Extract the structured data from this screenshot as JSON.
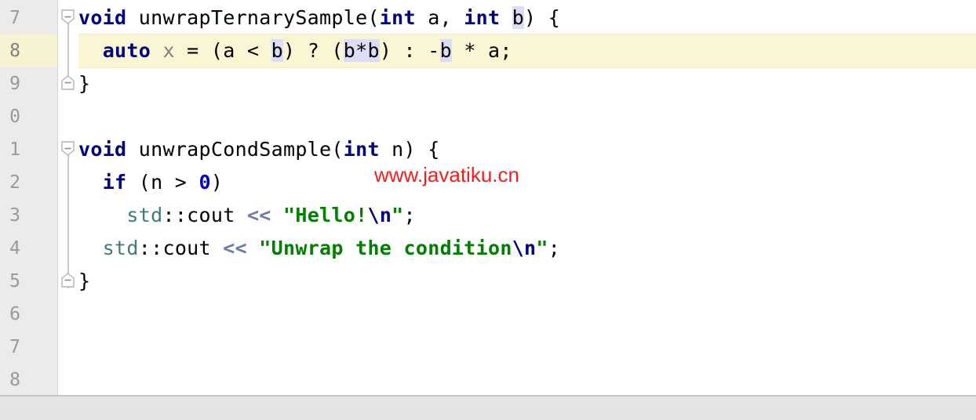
{
  "editor": {
    "language": "cpp",
    "line_height_px": 42,
    "first_visible_line": 7,
    "caret_line": 8,
    "colors": {
      "gutter_background": "#ebebeb",
      "editor_background": "#ffffff",
      "caret_line_highlight": "#faf6d4",
      "occurrence_highlight": "#dddcf7",
      "keyword": "#000080",
      "number": "#0000d0",
      "string": "#008000",
      "namespace": "#3f7b7b",
      "operator": "#6a7ba8",
      "local_variable": "#808080",
      "line_number": "#999999",
      "footer_background": "#e3e3e3",
      "watermark": "#ff1a1a"
    }
  },
  "gutter": {
    "line_numbers": [
      "7",
      "8",
      "9",
      "0",
      "1",
      "2",
      "3",
      "4",
      "5",
      "6",
      "7",
      "8"
    ],
    "fold_markers": [
      {
        "line": 7,
        "type": "collapse-start",
        "icon": "fold-minus-down-icon"
      },
      {
        "line": 9,
        "type": "collapse-end",
        "icon": "fold-minus-up-icon"
      },
      {
        "line": 11,
        "type": "collapse-start",
        "icon": "fold-minus-down-icon"
      },
      {
        "line": 15,
        "type": "collapse-end",
        "icon": "fold-minus-up-icon"
      }
    ]
  },
  "code": {
    "lines": [
      {
        "number": "7",
        "tokens": [
          {
            "text": "void",
            "kind": "kw"
          },
          {
            "text": " ",
            "kind": "plain"
          },
          {
            "text": "unwrapTernarySample(",
            "kind": "plain"
          },
          {
            "text": "int",
            "kind": "kw"
          },
          {
            "text": " a, ",
            "kind": "plain"
          },
          {
            "text": "int",
            "kind": "kw"
          },
          {
            "text": " ",
            "kind": "plain"
          },
          {
            "text": "b",
            "kind": "plain",
            "occurrence": true
          },
          {
            "text": ") {",
            "kind": "plain"
          }
        ]
      },
      {
        "number": "8",
        "tokens": [
          {
            "text": "  ",
            "kind": "plain"
          },
          {
            "text": "auto",
            "kind": "kw"
          },
          {
            "text": " ",
            "kind": "plain"
          },
          {
            "text": "x",
            "kind": "localvar"
          },
          {
            "text": " = (a < ",
            "kind": "plain"
          },
          {
            "text": "b",
            "kind": "plain",
            "occurrence": true
          },
          {
            "text": ") ? (",
            "kind": "plain"
          },
          {
            "text": "b",
            "kind": "plain",
            "occurrence": true
          },
          {
            "text": "*",
            "kind": "plain",
            "occurrence": true
          },
          {
            "text": "b",
            "kind": "plain",
            "occurrence": true
          },
          {
            "text": ") : -",
            "kind": "plain"
          },
          {
            "text": "b",
            "kind": "plain",
            "occurrence": true
          },
          {
            "text": " * a;",
            "kind": "plain"
          }
        ]
      },
      {
        "number": "9",
        "tokens": [
          {
            "text": "}",
            "kind": "plain"
          }
        ]
      },
      {
        "number": "0",
        "tokens": []
      },
      {
        "number": "1",
        "tokens": [
          {
            "text": "void",
            "kind": "kw"
          },
          {
            "text": " ",
            "kind": "plain"
          },
          {
            "text": "unwrapCondSample(",
            "kind": "plain"
          },
          {
            "text": "int",
            "kind": "kw"
          },
          {
            "text": " n) {",
            "kind": "plain"
          }
        ]
      },
      {
        "number": "2",
        "tokens": [
          {
            "text": "  ",
            "kind": "plain"
          },
          {
            "text": "if",
            "kind": "kw"
          },
          {
            "text": " (n > ",
            "kind": "plain"
          },
          {
            "text": "0",
            "kind": "num"
          },
          {
            "text": ")",
            "kind": "plain"
          }
        ]
      },
      {
        "number": "3",
        "tokens": [
          {
            "text": "    ",
            "kind": "plain"
          },
          {
            "text": "std",
            "kind": "ns"
          },
          {
            "text": "::cout ",
            "kind": "plain"
          },
          {
            "text": "<<",
            "kind": "op"
          },
          {
            "text": " ",
            "kind": "plain"
          },
          {
            "text": "\"Hello!",
            "kind": "str"
          },
          {
            "text": "\\n",
            "kind": "esc"
          },
          {
            "text": "\"",
            "kind": "str"
          },
          {
            "text": ";",
            "kind": "plain"
          }
        ]
      },
      {
        "number": "4",
        "tokens": [
          {
            "text": "  ",
            "kind": "plain"
          },
          {
            "text": "std",
            "kind": "ns"
          },
          {
            "text": "::cout ",
            "kind": "plain"
          },
          {
            "text": "<<",
            "kind": "op"
          },
          {
            "text": " ",
            "kind": "plain"
          },
          {
            "text": "\"Unwrap the condition",
            "kind": "str"
          },
          {
            "text": "\\n",
            "kind": "esc"
          },
          {
            "text": "\"",
            "kind": "str"
          },
          {
            "text": ";",
            "kind": "plain"
          }
        ]
      },
      {
        "number": "5",
        "tokens": [
          {
            "text": "}",
            "kind": "plain"
          }
        ]
      },
      {
        "number": "6",
        "tokens": []
      },
      {
        "number": "7",
        "tokens": []
      },
      {
        "number": "8",
        "tokens": []
      }
    ]
  },
  "watermark": {
    "text": "www.javatiku.cn"
  }
}
